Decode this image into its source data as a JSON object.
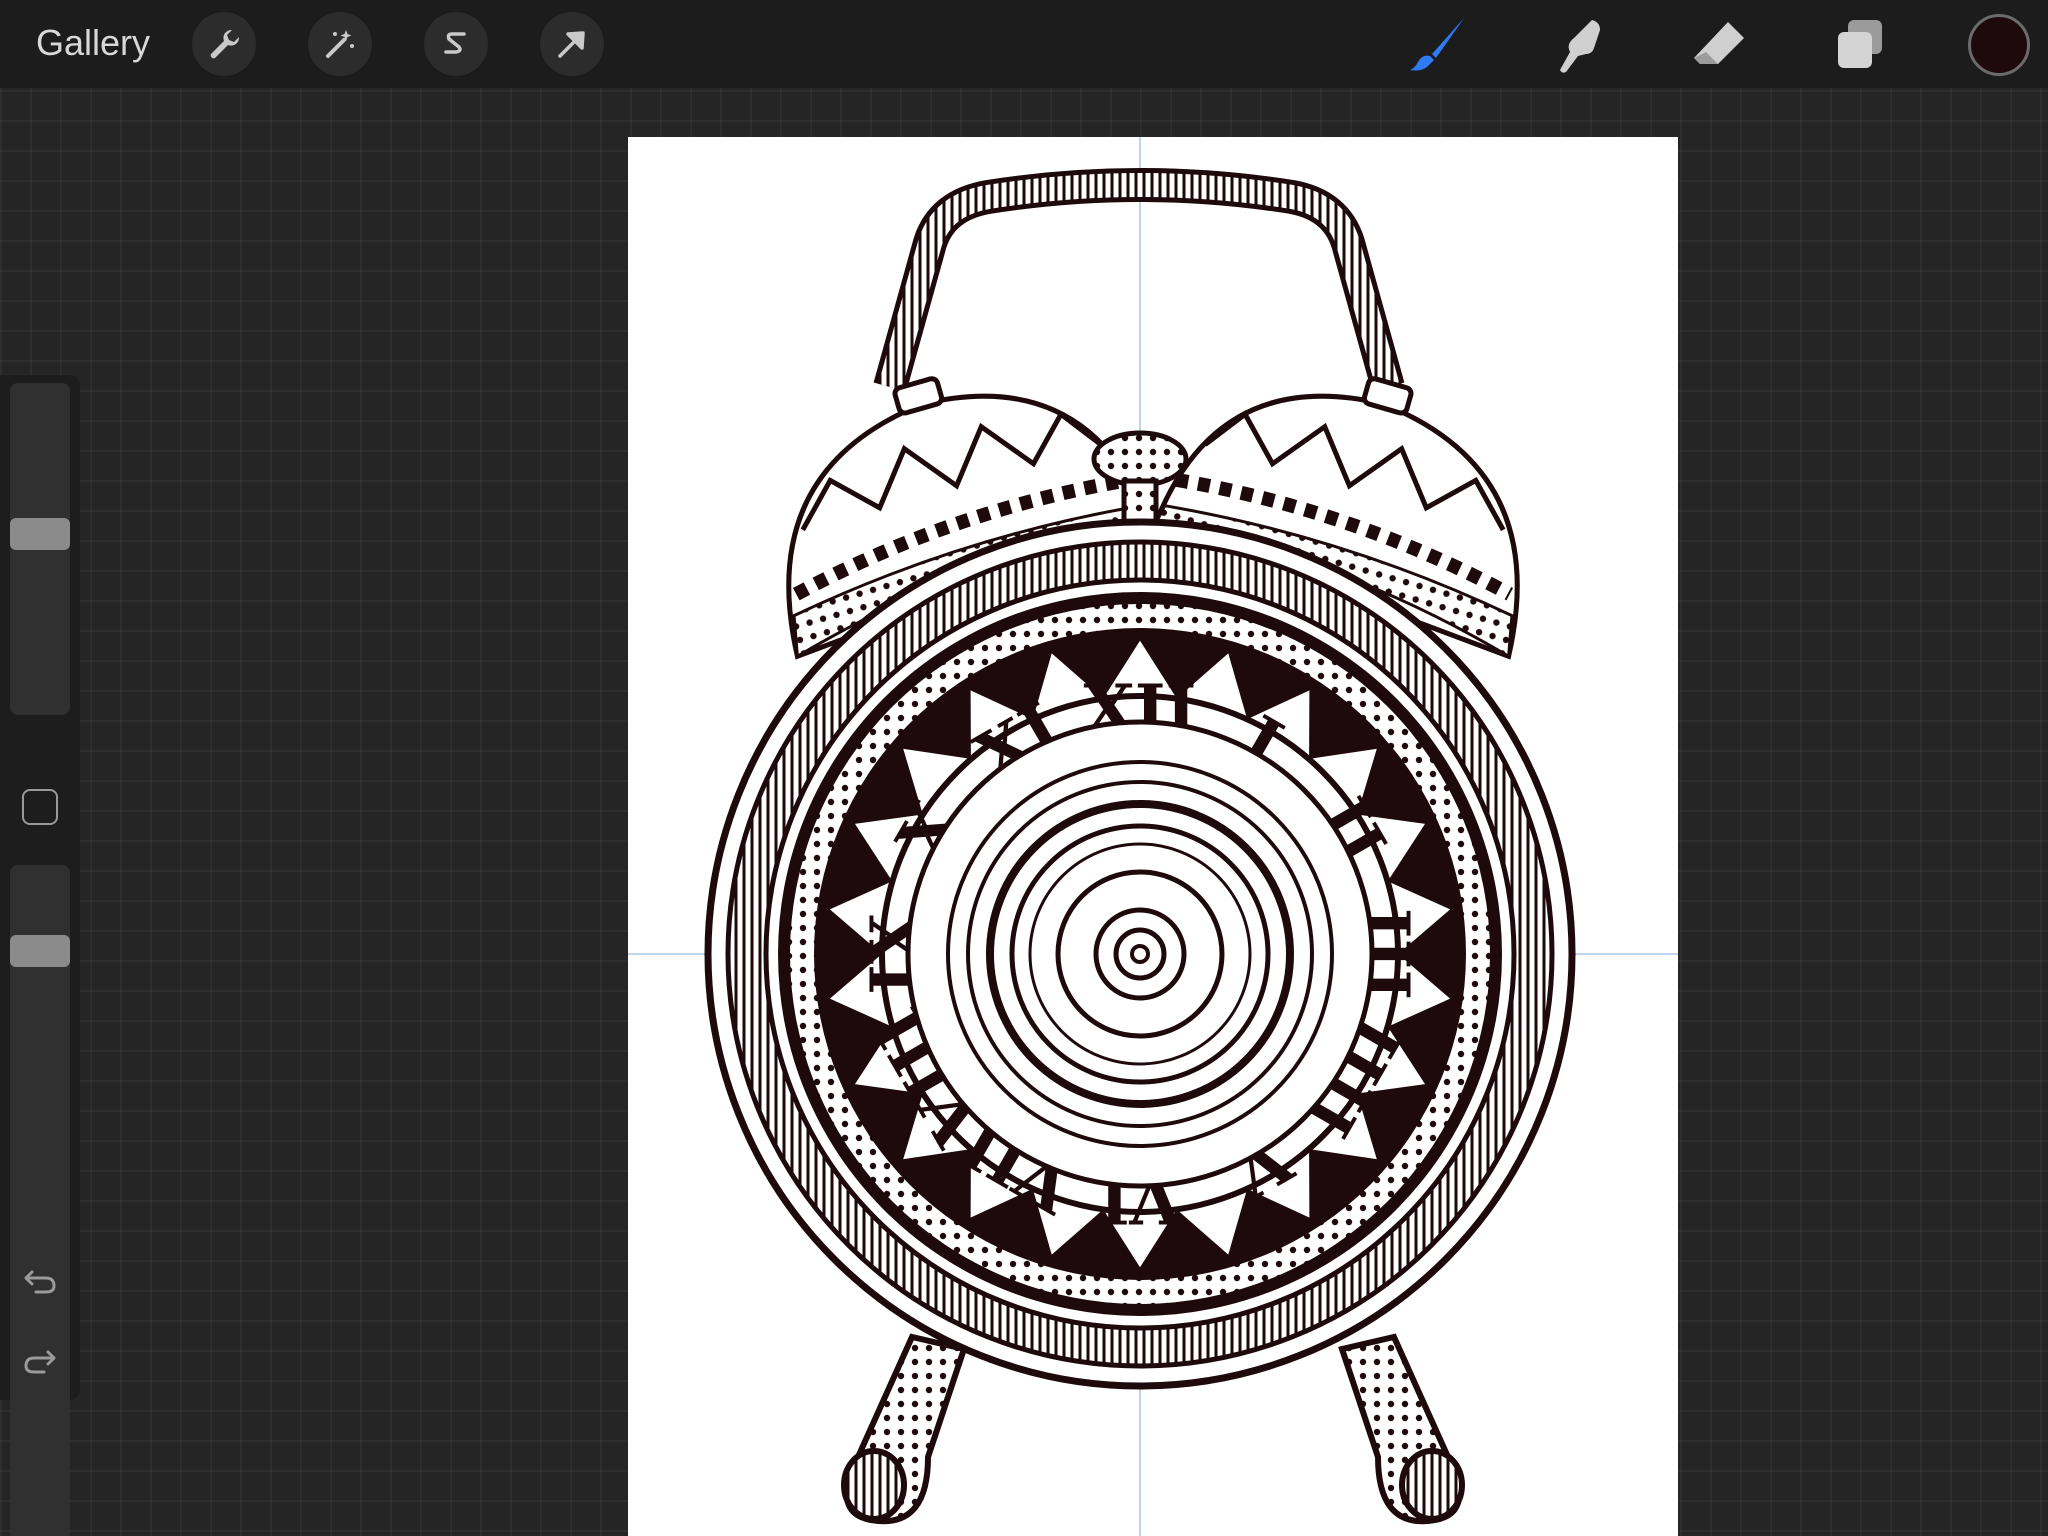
{
  "topbar": {
    "gallery_label": "Gallery",
    "left_tools": [
      "wrench-icon",
      "magic-wand-icon",
      "selection-icon",
      "transform-arrow-icon"
    ],
    "right_tools": [
      "brush-icon",
      "smudge-icon",
      "eraser-icon",
      "layers-icon"
    ],
    "active_tool": "brush",
    "active_color": "#1e0a0c",
    "accent_color": "#2f7bf5"
  },
  "sidebar": {
    "brush_size_level": 0.55,
    "opacity_level": 0.9,
    "modify_button": "square-icon",
    "undo": "undo-icon",
    "redo": "redo-icon"
  },
  "canvas": {
    "artwork": "alarm-clock-drawing",
    "roman_numerals": [
      "XII",
      "I",
      "II",
      "III",
      "IIII",
      "V",
      "VI",
      "VII",
      "VIII",
      "IX",
      "X",
      "XI"
    ],
    "ink_color": "#1e0a0c",
    "guide_color": "#a9c5e4"
  }
}
